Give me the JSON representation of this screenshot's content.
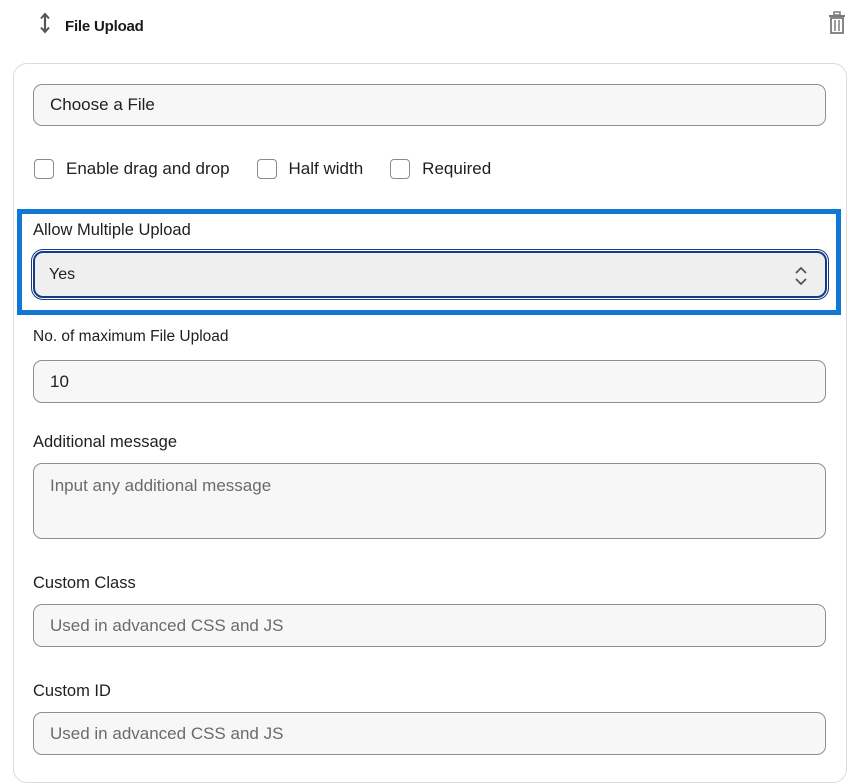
{
  "header": {
    "title": "File Upload",
    "drag_icon": "drag-vertical-icon",
    "delete_icon": "trash-icon"
  },
  "fields": {
    "choose_file": {
      "value": "Choose a File"
    },
    "checkboxes": [
      {
        "label": "Enable drag and drop",
        "checked": false
      },
      {
        "label": "Half width",
        "checked": false
      },
      {
        "label": "Required",
        "checked": false
      }
    ],
    "allow_multiple": {
      "label": "Allow Multiple Upload",
      "value": "Yes",
      "icon": "select-updown-icon"
    },
    "max_uploads": {
      "label": "No. of maximum File Upload",
      "value": "10"
    },
    "additional_message": {
      "label": "Additional message",
      "placeholder": "Input any additional message"
    },
    "custom_class": {
      "label": "Custom Class",
      "placeholder": "Used in advanced CSS and JS"
    },
    "custom_id": {
      "label": "Custom ID",
      "placeholder": "Used in advanced CSS and JS"
    }
  },
  "colors": {
    "highlight": "#1177d4",
    "focus_border": "#153b84",
    "field_border": "#8f8f8f"
  }
}
